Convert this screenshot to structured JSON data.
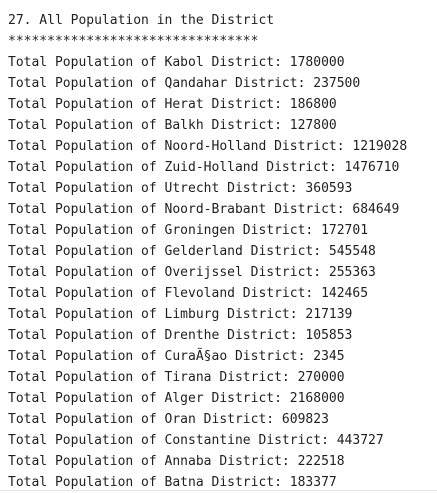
{
  "console": {
    "header": "27. All Population in the District",
    "separator": "********************************",
    "lines": [
      "Total Population of Kabol District: 1780000",
      "Total Population of Qandahar District: 237500",
      "Total Population of Herat District: 186800",
      "Total Population of Balkh District: 127800",
      "Total Population of Noord-Holland District: 1219028",
      "Total Population of Zuid-Holland District: 1476710",
      "Total Population of Utrecht District: 360593",
      "Total Population of Noord-Brabant District: 684649",
      "Total Population of Groningen District: 172701",
      "Total Population of Gelderland District: 545548",
      "Total Population of Overijssel District: 255363",
      "Total Population of Flevoland District: 142465",
      "Total Population of Limburg District: 217139",
      "Total Population of Drenthe District: 105853",
      "Total Population of CuraÃ§ao District: 2345",
      "Total Population of Tirana District: 270000",
      "Total Population of Alger District: 2168000",
      "Total Population of Oran District: 609823",
      "Total Population of Constantine District: 443727",
      "Total Population of Annaba District: 222518",
      "Total Population of Batna District: 183377"
    ]
  }
}
